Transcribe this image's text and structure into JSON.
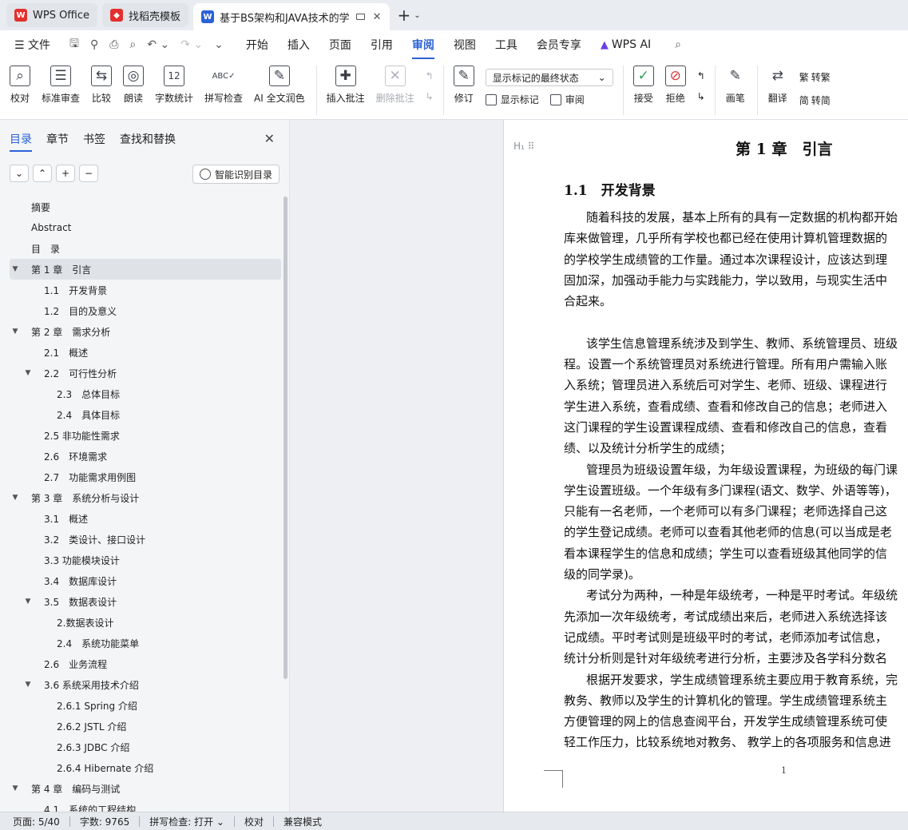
{
  "tabs": [
    {
      "label": "WPS Office",
      "logo": "W",
      "logo_color": "#e3302f"
    },
    {
      "label": "找稻壳模板",
      "logo": "稻",
      "logo_color": "#e3302f"
    },
    {
      "label": "基于BS架构和JAVA技术的学",
      "logo": "W",
      "logo_color": "#2b61d8",
      "active": true
    }
  ],
  "menubar": {
    "file": "文件",
    "items": [
      "开始",
      "插入",
      "页面",
      "引用",
      "审阅",
      "视图",
      "工具",
      "会员专享"
    ],
    "active": "审阅",
    "ai": "WPS AI"
  },
  "ribbon": {
    "proof": "校对",
    "std_review": "标准审查",
    "compare": "比较",
    "read_aloud": "朗读",
    "word_count": "字数统计",
    "spell_check": "拼写检查",
    "ai_polish": "AI 全文润色",
    "insert_comment": "插入批注",
    "delete_comment": "删除批注",
    "revise": "修订",
    "markup_select": "显示标记的最终状态",
    "show_markup": "显示标记",
    "review": "审阅",
    "accept": "接受",
    "reject": "拒绝",
    "ink": "画笔",
    "translate": "翻译",
    "to_trad": "转繁",
    "to_simp": "转简"
  },
  "nav": {
    "tabs": [
      "目录",
      "章节",
      "书签",
      "查找和替换"
    ],
    "active_tab": "目录",
    "smart_button": "智能识别目录",
    "toc": [
      {
        "label": "摘要",
        "level": 0,
        "tri": ""
      },
      {
        "label": "Abstract",
        "level": 0,
        "tri": ""
      },
      {
        "label": "目　录",
        "level": 0,
        "tri": ""
      },
      {
        "label": "第 1 章　引言",
        "level": 0,
        "tri": "▼",
        "selected": true
      },
      {
        "label": "1.1　开发背景",
        "level": 1,
        "tri": ""
      },
      {
        "label": "1.2　目的及意义",
        "level": 1,
        "tri": ""
      },
      {
        "label": "第 2 章　需求分析",
        "level": 0,
        "tri": "▼"
      },
      {
        "label": "2.1　概述",
        "level": 1,
        "tri": ""
      },
      {
        "label": "2.2　可行性分析",
        "level": 1,
        "tri": "▼"
      },
      {
        "label": "2.3　总体目标",
        "level": 2,
        "tri": ""
      },
      {
        "label": "2.4　具体目标",
        "level": 2,
        "tri": ""
      },
      {
        "label": "2.5 非功能性需求",
        "level": 1,
        "tri": ""
      },
      {
        "label": "2.6　环境需求",
        "level": 1,
        "tri": ""
      },
      {
        "label": "2.7　功能需求用例图",
        "level": 1,
        "tri": ""
      },
      {
        "label": "第 3 章　系统分析与设计",
        "level": 0,
        "tri": "▼"
      },
      {
        "label": "3.1　概述",
        "level": 1,
        "tri": ""
      },
      {
        "label": "3.2　类设计、接口设计",
        "level": 1,
        "tri": ""
      },
      {
        "label": "3.3 功能模块设计",
        "level": 1,
        "tri": ""
      },
      {
        "label": "3.4　数据库设计",
        "level": 1,
        "tri": ""
      },
      {
        "label": "3.5　数据表设计",
        "level": 1,
        "tri": "▼"
      },
      {
        "label": "2.数据表设计",
        "level": 2,
        "tri": ""
      },
      {
        "label": "2.4　系统功能菜单",
        "level": 2,
        "tri": ""
      },
      {
        "label": "2.6　业务流程",
        "level": 1,
        "tri": ""
      },
      {
        "label": "3.6 系统采用技术介绍",
        "level": 1,
        "tri": "▼"
      },
      {
        "label": "2.6.1 Spring 介绍",
        "level": 2,
        "tri": ""
      },
      {
        "label": "2.6.2 JSTL 介绍",
        "level": 2,
        "tri": ""
      },
      {
        "label": "2.6.3 JDBC 介绍",
        "level": 2,
        "tri": ""
      },
      {
        "label": "2.6.4 Hibernate 介绍",
        "level": 2,
        "tri": ""
      },
      {
        "label": "第 4 章　编码与测试",
        "level": 0,
        "tri": "▼"
      },
      {
        "label": "4.1　系统的工程结构",
        "level": 1,
        "tri": ""
      }
    ]
  },
  "page": {
    "heading_mark": "H₁",
    "chapter_title": "第 1 章　引言",
    "section_title": "1.1　开发背景",
    "lines": [
      {
        "t": "随着科技的发展，基本上所有的具有一定数据的机构都开始",
        "indent": true
      },
      {
        "t": "库来做管理，几乎所有学校也都已经在使用计算机管理数据的",
        "indent": false
      },
      {
        "t": "的学校学生成绩管的工作量。通过本次课程设计，应该达到理",
        "indent": false
      },
      {
        "t": "固加深，加强动手能力与实践能力，学以致用，与现实生活中",
        "indent": false
      },
      {
        "t": "合起来。",
        "indent": false
      },
      {
        "t": "",
        "indent": false
      },
      {
        "t": "该学生信息管理系统涉及到学生、教师、系统管理员、班级",
        "indent": true
      },
      {
        "t": "程。设置一个系统管理员对系统进行管理。所有用户需输入账",
        "indent": false
      },
      {
        "t": "入系统；管理员进入系统后可对学生、老师、班级、课程进行",
        "indent": false
      },
      {
        "t": "学生进入系统，查看成绩、查看和修改自己的信息；老师进入",
        "indent": false
      },
      {
        "t": "这门课程的学生设置课程成绩、查看和修改自己的信息，查看",
        "indent": false
      },
      {
        "t": "绩、以及统计分析学生的成绩；",
        "indent": false
      },
      {
        "t": "管理员为班级设置年级，为年级设置课程，为班级的每门课",
        "indent": true
      },
      {
        "t": "学生设置班级。一个年级有多门课程(语文、数学、外语等等)，",
        "indent": false
      },
      {
        "t": "只能有一名老师，一个老师可以有多门课程；老师选择自己这",
        "indent": false
      },
      {
        "t": "的学生登记成绩。老师可以查看其他老师的信息(可以当成是老",
        "indent": false
      },
      {
        "t": "看本课程学生的信息和成绩；学生可以查看班级其他同学的信",
        "indent": false
      },
      {
        "t": "级的同学录)。",
        "indent": false
      },
      {
        "t": "考试分为两种，一种是年级统考，一种是平时考试。年级统",
        "indent": true
      },
      {
        "t": "先添加一次年级统考，考试成绩出来后，老师进入系统选择该",
        "indent": false
      },
      {
        "t": "记成绩。平时考试则是班级平时的考试，老师添加考试信息，",
        "indent": false
      },
      {
        "t": "统计分析则是针对年级统考进行分析，主要涉及各学科分数名",
        "indent": false
      },
      {
        "t": "根据开发要求，学生成绩管理系统主要应用于教育系统，完",
        "indent": true
      },
      {
        "t": "教务、教师以及学生的计算机化的管理。学生成绩管理系统主",
        "indent": false
      },
      {
        "t": "方便管理的网上的信息查阅平台，开发学生成绩管理系统可使",
        "indent": false
      },
      {
        "t": "轻工作压力，比较系统地对教务、 教学上的各项服务和信息进",
        "indent": false
      }
    ],
    "page_number": "1"
  },
  "status": {
    "page": "页面: 5/40",
    "words": "字数: 9765",
    "spell": "拼写检查: 打开",
    "proof": "校对",
    "compat": "兼容模式"
  },
  "colors": {
    "accent": "#2b61d8",
    "wps_red": "#e3302f",
    "ai_purple": "#6a3ee6"
  }
}
